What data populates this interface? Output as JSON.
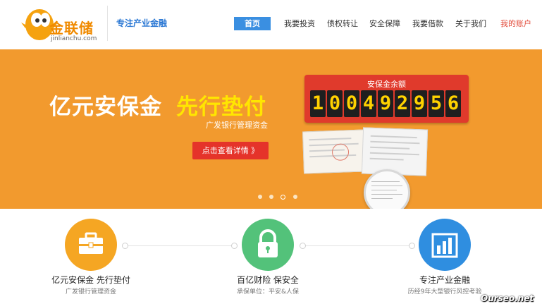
{
  "header": {
    "logo_text": "金联储",
    "logo_sub": "jinlianchu.com",
    "slogan": "专注产业金融",
    "nav": [
      {
        "label": "首页"
      },
      {
        "label": "我要投资"
      },
      {
        "label": "债权转让"
      },
      {
        "label": "安全保障"
      },
      {
        "label": "我要借款"
      },
      {
        "label": "关于我们"
      },
      {
        "label": "我的账户"
      }
    ]
  },
  "banner": {
    "title_main": "亿元安保金",
    "title_highlight": "先行垫付",
    "subtitle": "广发银行管理资金",
    "button_label": "点击查看详情 》",
    "counter_label": "安保金余额",
    "counter_digits": [
      "1",
      "0",
      "0",
      "4",
      "9",
      "2",
      "9",
      "5",
      "6"
    ],
    "slide_count": 4,
    "active_slide": 3
  },
  "features": [
    {
      "title": "亿元安保金 先行垫付",
      "desc": "广发银行管理资金",
      "icon": "briefcase-icon",
      "color": "#f5a623"
    },
    {
      "title": "百亿财险 保安全",
      "desc": "承保单位：平安&人保",
      "icon": "lock-icon",
      "color": "#53c27a"
    },
    {
      "title": "专注产业金融",
      "desc": "历经9年大型银行风控考验",
      "icon": "bar-chart-icon",
      "color": "#2f8ee0"
    }
  ],
  "watermark": "Ourseo.net",
  "colors": {
    "brand_orange": "#f29a2e",
    "nav_active": "#3a8fe1",
    "button_red": "#e5332a",
    "counter_digit": "#ffd200",
    "account_link": "#e24b3a"
  }
}
